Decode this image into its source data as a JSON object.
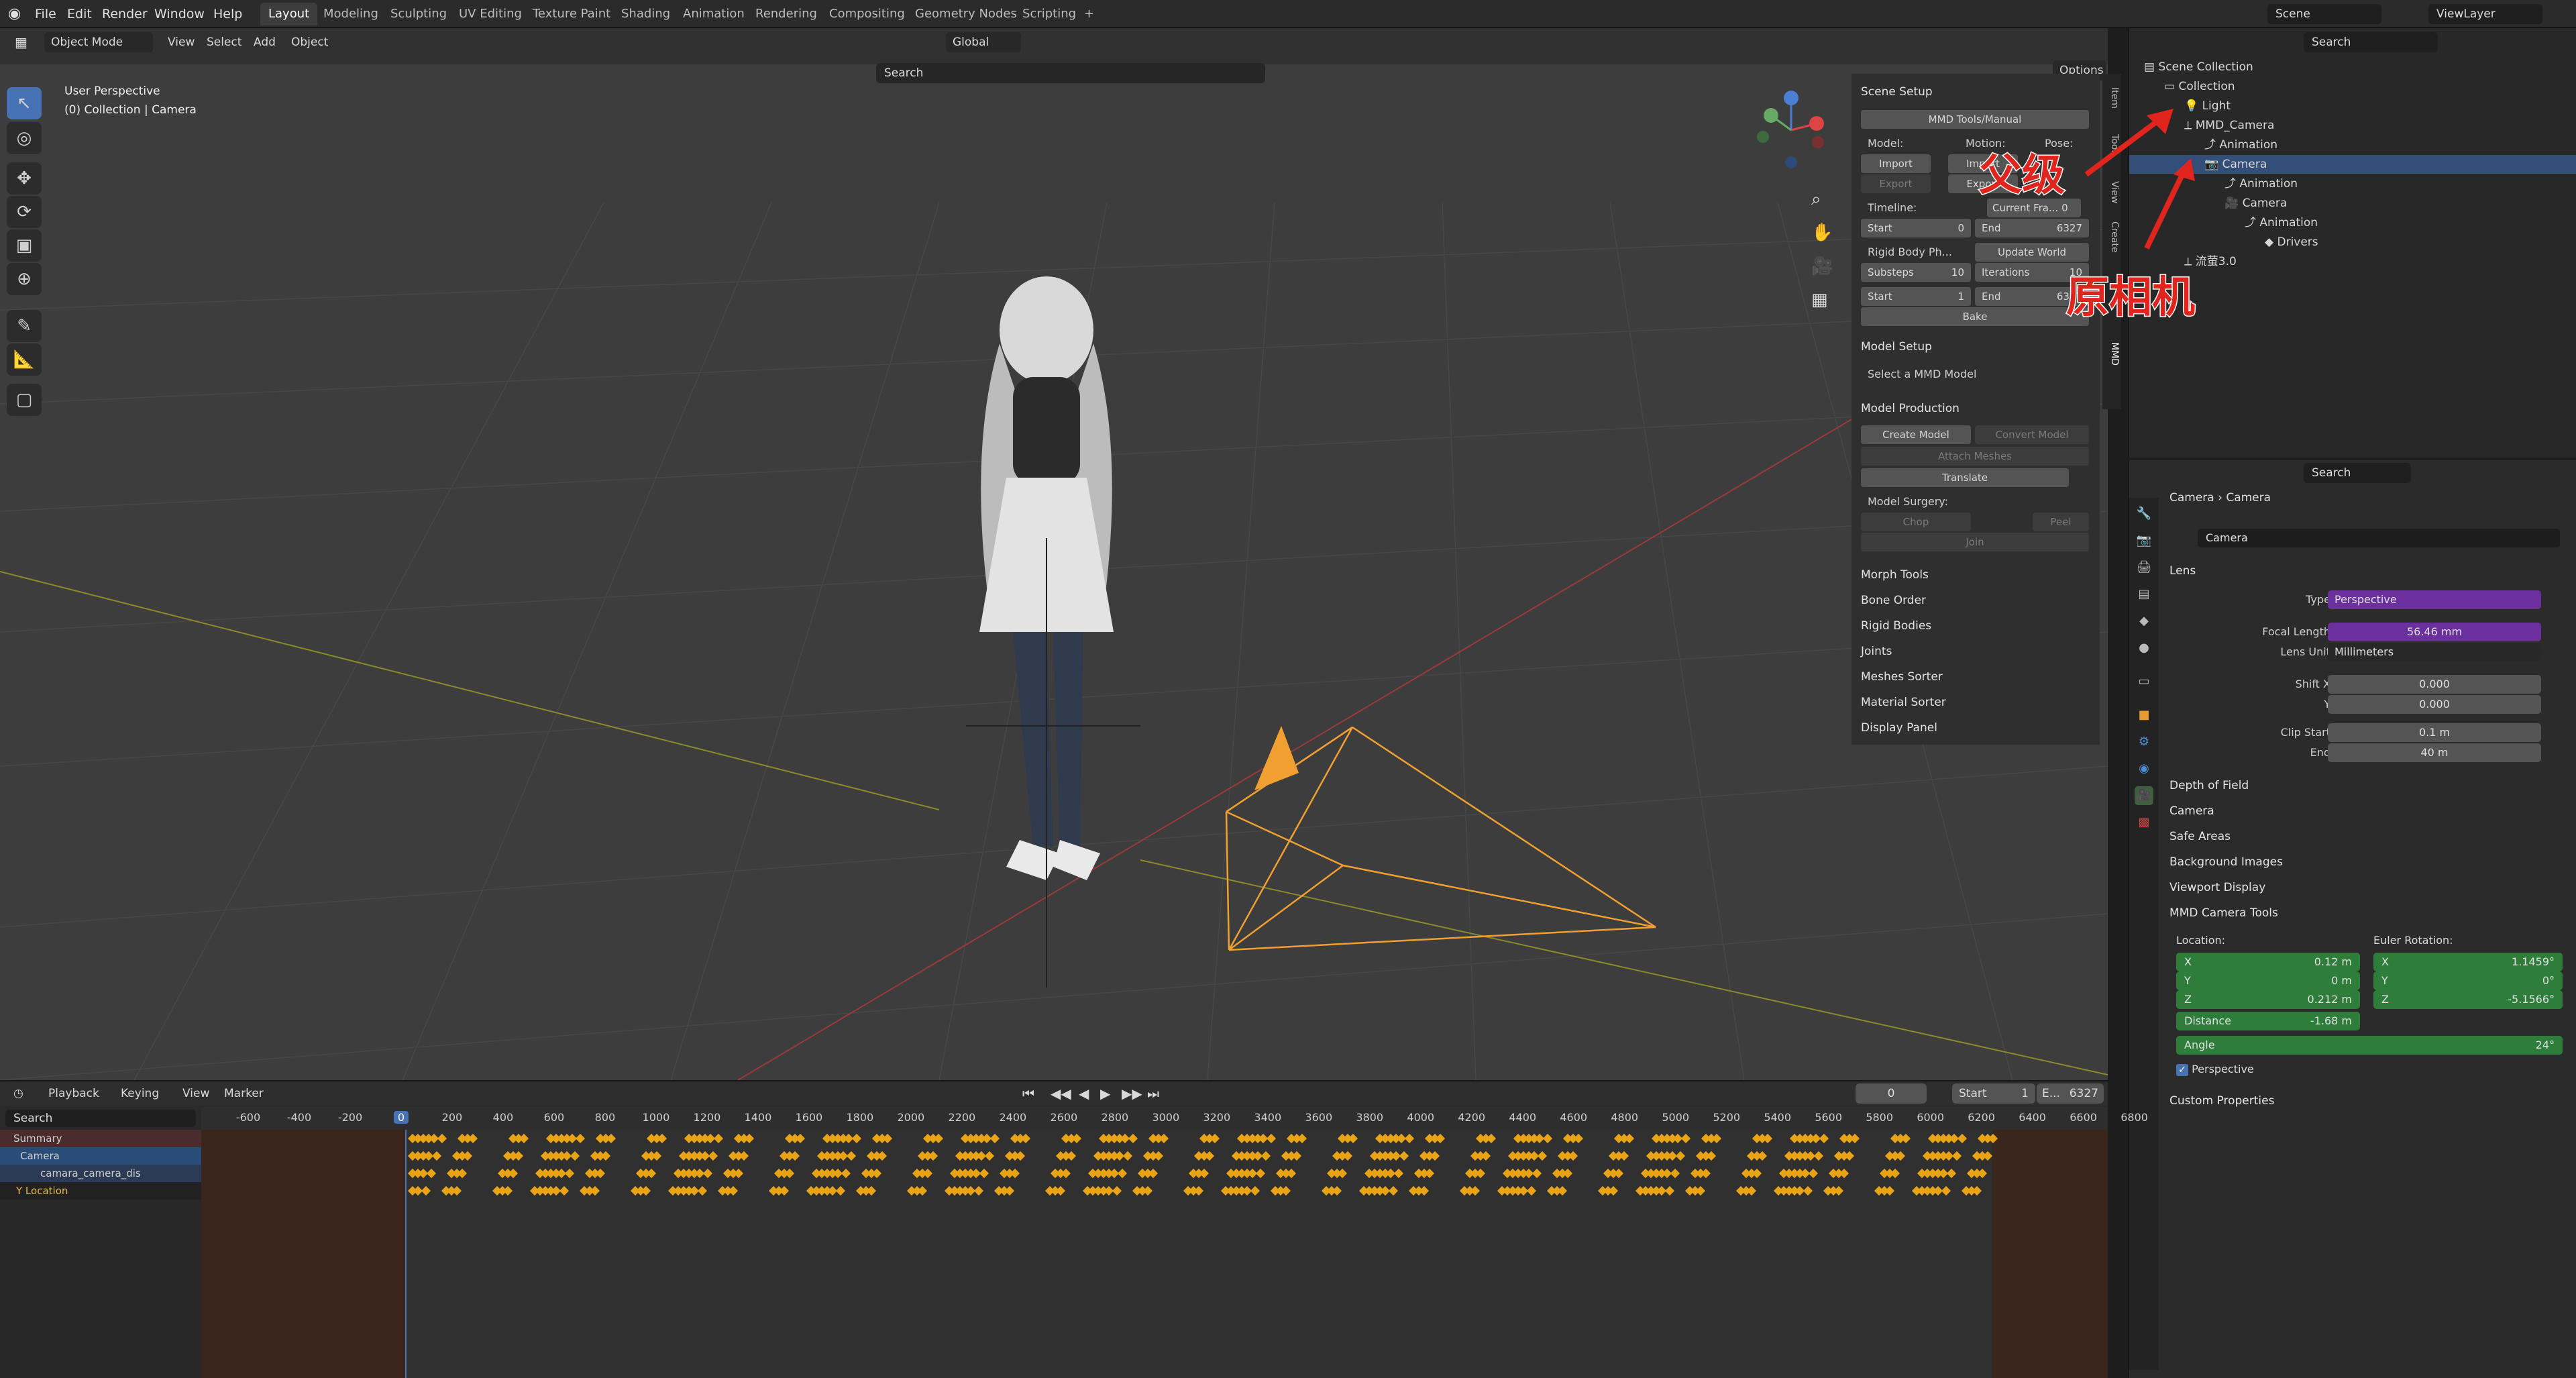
{
  "menubar": {
    "items": [
      "File",
      "Edit",
      "Render",
      "Window",
      "Help"
    ],
    "workspaces": [
      "Layout",
      "Modeling",
      "Sculpting",
      "UV Editing",
      "Texture Paint",
      "Shading",
      "Animation",
      "Rendering",
      "Compositing",
      "Geometry Nodes",
      "Scripting"
    ],
    "active_workspace": "Layout",
    "scene": "Scene",
    "view_layer": "ViewLayer"
  },
  "viewport": {
    "mode": "Object Mode",
    "menus": [
      "View",
      "Select",
      "Add",
      "Object"
    ],
    "transform_orientation": "Global",
    "search_placeholder": "Search",
    "options": "Options",
    "overlay_title": "User Perspective",
    "overlay_sub": "(0) Collection | Camera",
    "vertical_tabs": [
      "Item",
      "Tool",
      "View",
      "Create",
      "MMD"
    ]
  },
  "npanel": {
    "scene_setup": "Scene Setup",
    "manual_btn": "MMD Tools/Manual",
    "model_lbl": "Model:",
    "motion_lbl": "Motion:",
    "pose_lbl": "Pose:",
    "import": "Import",
    "export": "Export",
    "timeline_lbl": "Timeline:",
    "current_frame": "Current Fra...",
    "current_frame_val": "0",
    "start": "Start",
    "start_val": "0",
    "end": "End",
    "end_val": "6327",
    "rigid_body": "Rigid Body Ph...",
    "update_world": "Update World",
    "substeps": "Substeps",
    "substeps_val": "10",
    "iterations": "Iterations",
    "iterations_val": "10",
    "start2_val": "1",
    "end2_val": "6327",
    "bake": "Bake",
    "model_setup": "Model Setup",
    "select_model": "Select a MMD Model",
    "model_production": "Model Production",
    "create_model": "Create Model",
    "convert_model": "Convert Model",
    "attach_meshes": "Attach Meshes",
    "translate": "Translate",
    "model_surgery": "Model Surgery:",
    "chop": "Chop",
    "peel": "Peel",
    "join": "Join",
    "collapsed": [
      "Morph Tools",
      "Bone Order",
      "Rigid Bodies",
      "Joints",
      "Meshes Sorter",
      "Material Sorter",
      "Display Panel"
    ]
  },
  "outliner": {
    "search_placeholder": "Search",
    "rows": [
      {
        "label": "Scene Collection",
        "indent": 0
      },
      {
        "label": "Collection",
        "indent": 1
      },
      {
        "label": "Light",
        "indent": 2
      },
      {
        "label": "MMD_Camera",
        "indent": 2
      },
      {
        "label": "Animation",
        "indent": 3
      },
      {
        "label": "Camera",
        "indent": 3,
        "selected": true
      },
      {
        "label": "Animation",
        "indent": 4
      },
      {
        "label": "Camera",
        "indent": 4
      },
      {
        "label": "Animation",
        "indent": 5
      },
      {
        "label": "Drivers",
        "indent": 6
      },
      {
        "label": "流萤3.0",
        "indent": 2
      }
    ],
    "annotation_parent": "父级",
    "annotation_original": "原相机"
  },
  "properties": {
    "search_placeholder": "Search",
    "breadcrumb": [
      "Camera",
      "Camera"
    ],
    "datablock": "Camera",
    "lens_section": "Lens",
    "type_lbl": "Type",
    "type_val": "Perspective",
    "focal_lbl": "Focal Length",
    "focal_val": "56.46 mm",
    "lens_unit_lbl": "Lens Unit",
    "lens_unit_val": "Millimeters",
    "shift_x_lbl": "Shift X",
    "shift_x_val": "0.000",
    "shift_y_lbl": "Y",
    "shift_y_val": "0.000",
    "clip_start_lbl": "Clip Start",
    "clip_start_val": "0.1 m",
    "clip_end_lbl": "End",
    "clip_end_val": "40 m",
    "sections": [
      "Depth of Field",
      "Camera",
      "Safe Areas",
      "Background Images",
      "Viewport Display",
      "MMD Camera Tools"
    ],
    "location_lbl": "Location:",
    "euler_lbl": "Euler Rotation:",
    "loc": [
      {
        "k": "X",
        "v": "0.12 m"
      },
      {
        "k": "Y",
        "v": "0 m"
      },
      {
        "k": "Z",
        "v": "0.212 m"
      }
    ],
    "rot": [
      {
        "k": "X",
        "v": "1.1459°"
      },
      {
        "k": "Y",
        "v": "0°"
      },
      {
        "k": "Z",
        "v": "-5.1566°"
      }
    ],
    "distance_lbl": "Distance",
    "distance_val": "-1.68 m",
    "angle_lbl": "Angle",
    "angle_val": "24°",
    "perspective_lbl": "Perspective",
    "custom_props": "Custom Properties"
  },
  "timeline": {
    "menus": [
      "Playback",
      "Keying",
      "View",
      "Marker"
    ],
    "current": "0",
    "start_lbl": "Start",
    "start_val": "1",
    "end_lbl": "E...",
    "end_val": "6327",
    "search_placeholder": "Search",
    "ruler": [
      "-600",
      "-400",
      "-200",
      "0",
      "200",
      "400",
      "600",
      "800",
      "1000",
      "1200",
      "1400",
      "1600",
      "1800",
      "2000",
      "2200",
      "2400",
      "2600",
      "2800",
      "3000",
      "3200",
      "3400",
      "3600",
      "3800",
      "4000",
      "4200",
      "4400",
      "4600",
      "4800",
      "5000",
      "5200",
      "5400",
      "5600",
      "5800",
      "6000",
      "6200",
      "6400",
      "6600",
      "6800"
    ],
    "channels": [
      "Summary",
      "Camera",
      "camara_camera_dis",
      "Y Location"
    ],
    "accent": "#e8a317"
  }
}
